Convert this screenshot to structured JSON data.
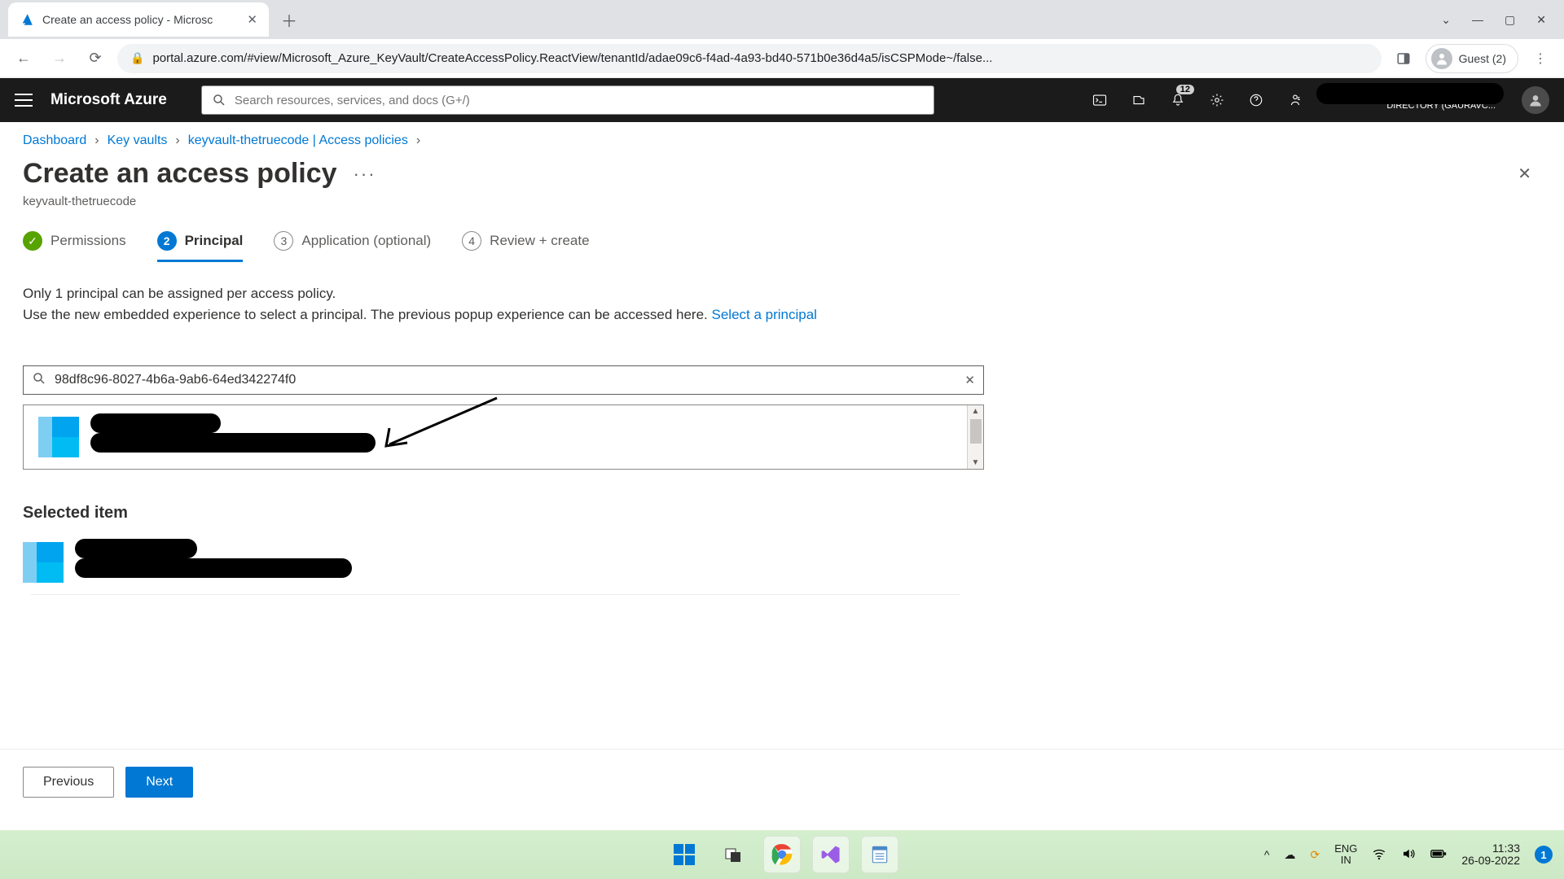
{
  "browser": {
    "tab_title": "Create an access policy - Microsc",
    "url": "portal.azure.com/#view/Microsoft_Azure_KeyVault/CreateAccessPolicy.ReactView/tenantId/adae09c6-f4ad-4a93-bd40-571b0e36d4a5/isCSPMode~/false...",
    "guest_label": "Guest (2)"
  },
  "azure_bar": {
    "logo": "Microsoft Azure",
    "search_placeholder": "Search resources, services, and docs (G+/)",
    "notif_badge": "12",
    "directory_label": "DIRECTORY (GAURAVC..."
  },
  "breadcrumbs": {
    "items": [
      "Dashboard",
      "Key vaults",
      "keyvault-thetruecode | Access policies"
    ]
  },
  "page": {
    "title": "Create an access policy",
    "subtitle": "keyvault-thetruecode"
  },
  "steps": {
    "s1": "Permissions",
    "s2": "Principal",
    "s3": "Application (optional)",
    "s4": "Review + create",
    "n2": "2",
    "n3": "3",
    "n4": "4"
  },
  "info": {
    "line1": "Only 1 principal can be assigned per access policy.",
    "line2a": "Use the new embedded experience to select a principal. The previous popup experience can be accessed here. ",
    "link": "Select a principal"
  },
  "search": {
    "value": "98df8c96-8027-4b6a-9ab6-64ed342274f0"
  },
  "selected": {
    "heading": "Selected item"
  },
  "footer": {
    "prev": "Previous",
    "next": "Next"
  },
  "taskbar": {
    "lang1": "ENG",
    "lang2": "IN",
    "time": "11:33",
    "date": "26-09-2022",
    "notif": "1"
  }
}
